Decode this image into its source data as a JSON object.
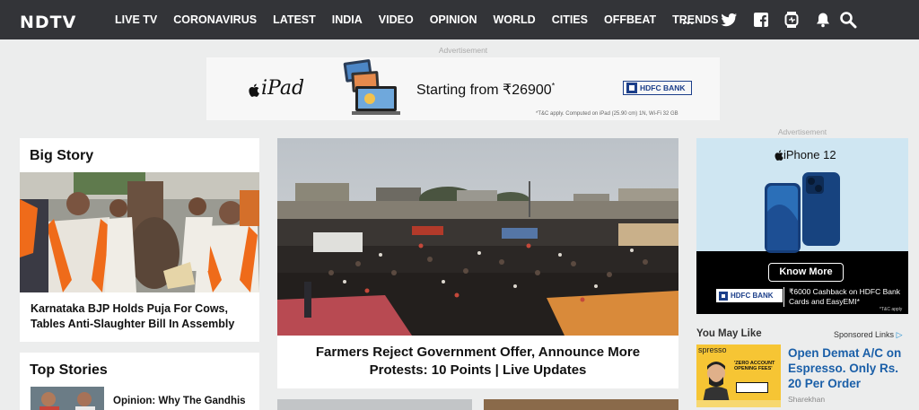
{
  "nav": {
    "logo": "NDTV",
    "items": [
      "LIVE TV",
      "CORONAVIRUS",
      "LATEST",
      "INDIA",
      "VIDEO",
      "OPINION",
      "WORLD",
      "CITIES",
      "OFFBEAT",
      "TRENDS"
    ],
    "more": "..."
  },
  "top_ad": {
    "label": "Advertisement",
    "brand": "iPad",
    "offer": "Starting from ₹26900",
    "asterisk": "*",
    "bank": "HDFC BANK",
    "terms": "*T&C apply. Computed on iPad (25.90 cm) 1N, Wi-Fi 32 GB"
  },
  "big_story": {
    "heading": "Big Story",
    "headline": "Karnataka BJP Holds Puja For Cows, Tables Anti-Slaughter Bill In Assembly"
  },
  "lead": {
    "headline": "Farmers Reject Government Offer, Announce More Protests: 10 Points | Live Updates"
  },
  "top_stories": {
    "heading": "Top Stories",
    "first": "Opinion: Why The Gandhis"
  },
  "side_ad": {
    "label": "Advertisement",
    "product": "iPhone 12",
    "button": "Know More",
    "bank": "HDFC BANK",
    "offer": "₹6000 Cashback on HDFC Bank Cards and EasyEMI*",
    "terms": "*T&C apply"
  },
  "you_may_like": {
    "heading": "You May Like",
    "sponsored": "Sponsored Links",
    "headline": "Open Demat A/C on Espresso. Only Rs. 20 Per Order",
    "source": "Sharekhan",
    "thumb_brand": "spresso",
    "thumb_text": "'ZERO ACCOUNT OPENING FEES'"
  }
}
